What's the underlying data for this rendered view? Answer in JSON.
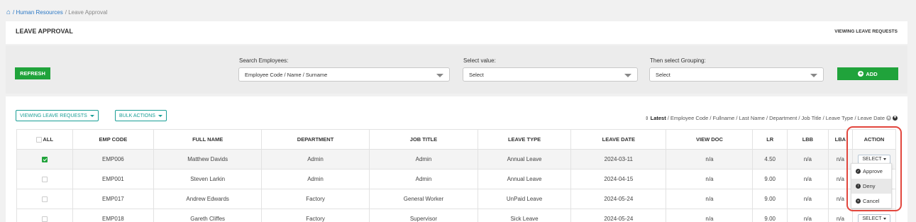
{
  "breadcrumb": {
    "home_icon": "home-icon",
    "section": "/ Human Resources",
    "current": "/ Leave Approval"
  },
  "header": {
    "title": "LEAVE APPROVAL",
    "right_label": "VIEWING LEAVE REQUESTS"
  },
  "filters": {
    "refresh_label": "REFRESH",
    "search_label": "Search Employees:",
    "search_value": "Employee Code / Name / Surname",
    "value_label": "Select value:",
    "value_value": "Select",
    "group_label": "Then select Grouping:",
    "group_value": "Select",
    "add_label": "ADD"
  },
  "toolbar": {
    "view_label": "VIEWING LEAVE REQUESTS",
    "bulk_label": "BULK ACTIONS",
    "sort_prefix": "Latest",
    "sort_rest": "/ Employee Code / Fullname / Last Name / Department / Job Title / Leave Type / Leave Date"
  },
  "table": {
    "columns": [
      "ALL",
      "EMP CODE",
      "FULL NAME",
      "DEPARTMENT",
      "JOB TITLE",
      "LEAVE TYPE",
      "LEAVE DATE",
      "VIEW DOC",
      "LR",
      "LBB",
      "LBA",
      "ACTION"
    ],
    "rows": [
      {
        "checked": true,
        "code": "EMP006",
        "name": "Matthew Davids",
        "dept": "Admin",
        "job": "Admin",
        "type": "Annual Leave",
        "date": "2024-03-11",
        "doc": "n/a",
        "lr": "4.50",
        "lbb": "n/a",
        "lba": "n/a",
        "action": "SELECT"
      },
      {
        "checked": false,
        "code": "EMP001",
        "name": "Steven Larkin",
        "dept": "Admin",
        "job": "Admin",
        "type": "Annual Leave",
        "date": "2024-04-15",
        "doc": "n/a",
        "lr": "9.00",
        "lbb": "n/a",
        "lba": "n/a",
        "action": ""
      },
      {
        "checked": false,
        "code": "EMP017",
        "name": "Andrew Edwards",
        "dept": "Factory",
        "job": "General Worker",
        "type": "UnPaid Leave",
        "date": "2024-05-24",
        "doc": "n/a",
        "lr": "9.00",
        "lbb": "n/a",
        "lba": "n/a",
        "action": ""
      },
      {
        "checked": false,
        "code": "EMP018",
        "name": "Gareth Cliffes",
        "dept": "Factory",
        "job": "Supervisor",
        "type": "Sick Leave",
        "date": "2024-05-24",
        "doc": "n/a",
        "lr": "9.00",
        "lbb": "n/a",
        "lba": "n/a",
        "action": "SELECT"
      }
    ]
  },
  "action_menu": {
    "items": [
      {
        "label": "Approve",
        "icon": "check-circle-icon"
      },
      {
        "label": "Deny",
        "icon": "exclamation-circle-icon"
      },
      {
        "label": "Cancel",
        "icon": "times-circle-icon"
      }
    ]
  },
  "colors": {
    "green": "#20a33b",
    "teal": "#1a9e96",
    "link": "#2b78c5",
    "highlight": "#e2463d"
  }
}
